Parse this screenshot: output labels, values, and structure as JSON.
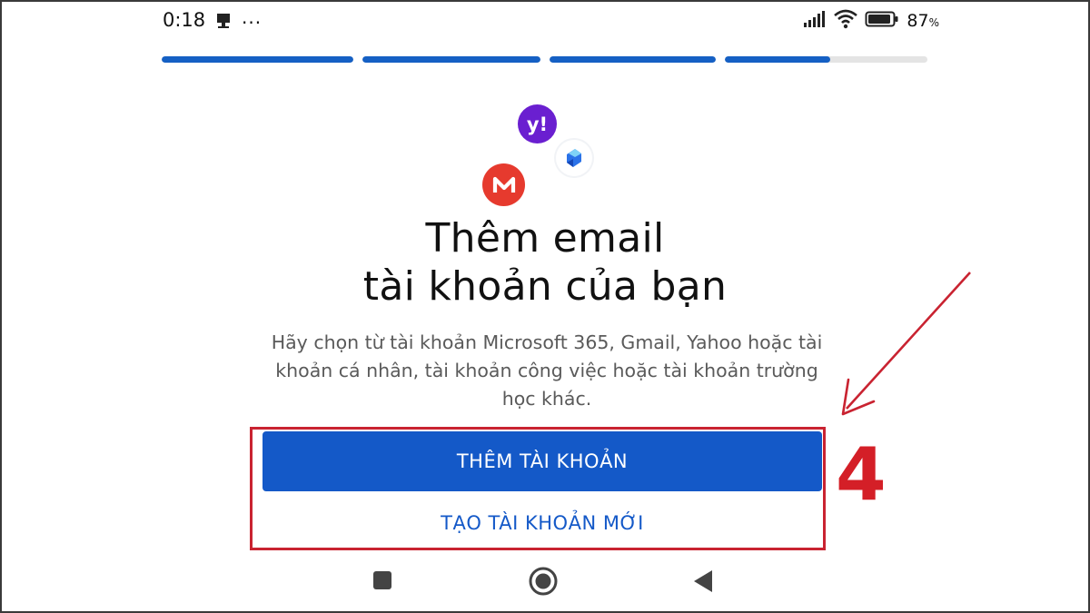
{
  "status_bar": {
    "time": "0:18",
    "more_dots": "···",
    "battery_percent": "87",
    "battery_unit": "%",
    "icons": [
      "notification-icon",
      "signal-icon",
      "wifi-icon",
      "battery-icon"
    ]
  },
  "progress": {
    "segments": [
      1.0,
      1.0,
      1.0,
      0.52
    ],
    "accent_color": "#1560c4",
    "track_color": "#e4e4e4"
  },
  "logos": [
    "yahoo-logo",
    "copilot-logo",
    "mega-logo"
  ],
  "yahoo_mark": "y!",
  "title_line1": "Thêm email",
  "title_line2": "tài khoản của bạn",
  "subtitle": "Hãy chọn từ tài khoản Microsoft 365, Gmail, Yahoo hoặc tài khoản cá nhân, tài khoản công việc hoặc tài khoản trường học khác.",
  "buttons": {
    "add_account": "THÊM TÀI KHOẢN",
    "create_account": "TẠO TÀI KHOẢN MỚI"
  },
  "annotation": {
    "step_number": "4",
    "color": "#d41f27"
  },
  "nav_bar": [
    "recents-icon",
    "home-icon",
    "back-icon"
  ]
}
